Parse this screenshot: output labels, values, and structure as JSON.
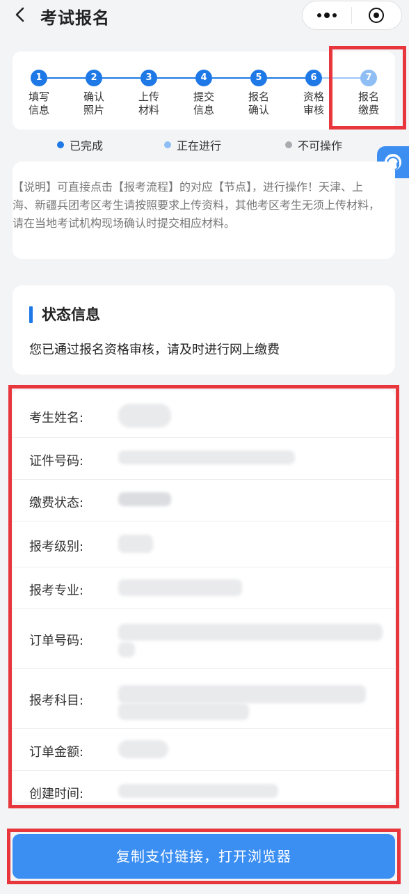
{
  "header": {
    "title": "考试报名",
    "back_icon": "chevron-left-icon",
    "more_icon": "more-dots-icon",
    "close_icon": "target-circle-icon"
  },
  "steps": [
    {
      "num": "1",
      "line1": "填写",
      "line2": "信息",
      "state": "done"
    },
    {
      "num": "2",
      "line1": "确认",
      "line2": "照片",
      "state": "done"
    },
    {
      "num": "3",
      "line1": "上传",
      "line2": "材料",
      "state": "done"
    },
    {
      "num": "4",
      "line1": "提交",
      "line2": "信息",
      "state": "done"
    },
    {
      "num": "5",
      "line1": "报名",
      "line2": "确认",
      "state": "done"
    },
    {
      "num": "6",
      "line1": "资格",
      "line2": "审核",
      "state": "done"
    },
    {
      "num": "7",
      "line1": "报名",
      "line2": "缴费",
      "state": "current"
    }
  ],
  "legend": {
    "done": "已完成",
    "current": "正在进行",
    "disabled": "不可操作",
    "done_color": "#1e78e6",
    "current_color": "#8fbef5",
    "disabled_color": "#a8abb0"
  },
  "note": "【说明】可直接点击【报考流程】的对应【节点】，进行操作！天津、上海、新疆兵团考区考生请按照要求上传资料，其他考区考生无须上传材料，请在当地考试机构现场确认时提交相应材料。",
  "status": {
    "title": "状态信息",
    "message": "您已通过报名资格审核，请及时进行网上缴费"
  },
  "info": {
    "name_label": "考生姓名:",
    "id_label": "证件号码:",
    "pay_status_label": "缴费状态:",
    "level_label": "报考级别:",
    "major_label": "报考专业:",
    "order_no_label": "订单号码:",
    "subject_label": "报考科目:",
    "amount_label": "订单金额:",
    "created_label": "创建时间:"
  },
  "pay_button": "复制支付链接，打开浏览器",
  "colors": {
    "accent": "#1e78e6",
    "highlight_red": "#e8363d",
    "button_blue": "#3b8ef2"
  }
}
